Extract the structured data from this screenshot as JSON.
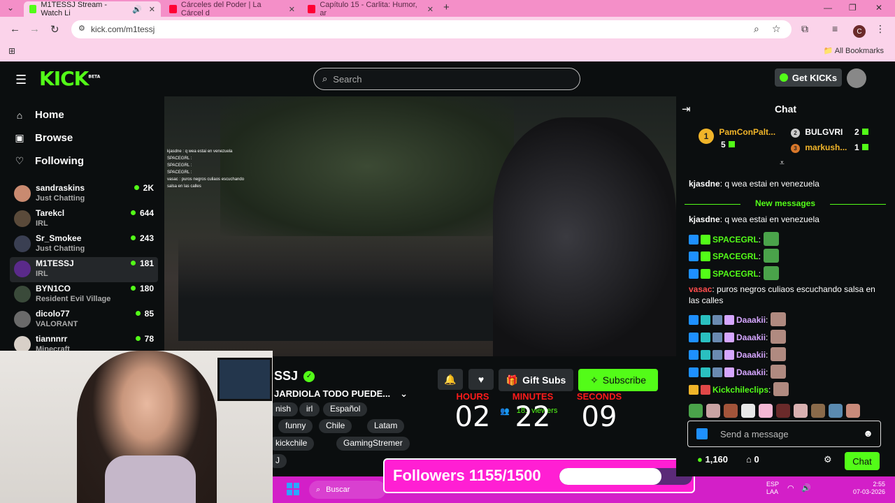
{
  "browser": {
    "tabs": [
      {
        "label": "M1TESSJ Stream - Watch Li",
        "favicon": "kick-icon"
      },
      {
        "label": "Cárceles del Poder | La Cárcel d",
        "favicon": "youtube-icon"
      },
      {
        "label": "Capítulo 15 - Carlita: Humor, ar",
        "favicon": "youtube-icon"
      }
    ],
    "new_tab": "+",
    "url": "kick.com/m1tessj",
    "profile_initial": "C",
    "all_bookmarks": "All Bookmarks"
  },
  "kick": {
    "logo": "KICK",
    "logo_sup": "BETA",
    "search_placeholder": "Search",
    "get_kicks": "Get KICKs"
  },
  "sidebar": {
    "nav": [
      {
        "label": "Home",
        "icon": "home-icon"
      },
      {
        "label": "Browse",
        "icon": "browse-icon"
      },
      {
        "label": "Following",
        "icon": "heart-icon"
      }
    ],
    "channels": [
      {
        "name": "sandraskins",
        "category": "Just Chatting",
        "viewers": "2K",
        "color": "#c98a70"
      },
      {
        "name": "Tarekcl",
        "category": "IRL",
        "viewers": "644",
        "color": "#5a4a3a"
      },
      {
        "name": "Sr_Smokee",
        "category": "Just Chatting",
        "viewers": "243",
        "color": "#3a3f52"
      },
      {
        "name": "M1TESSJ",
        "category": "IRL",
        "viewers": "181",
        "color": "#5a2a8a"
      },
      {
        "name": "BYN1CO",
        "category": "Resident Evil Village",
        "viewers": "180",
        "color": "#3a4a3a"
      },
      {
        "name": "dicolo77",
        "category": "VALORANT",
        "viewers": "85",
        "color": "#6a6a6a"
      },
      {
        "name": "tiannnrr",
        "category": "Minecraft",
        "viewers": "78",
        "color": "#d8d0c8"
      }
    ]
  },
  "stream": {
    "channel_name": "SSJ",
    "title": "JARDIOLA TODO PUEDE...",
    "tags": [
      "nish",
      "irl",
      "Español",
      "funny",
      "Chile",
      "Latam",
      "kickchile",
      "GamingStremer",
      "J"
    ],
    "gift_subs": "Gift Subs",
    "subscribe": "Subscribe",
    "viewers": "181 viewers",
    "overlay_chat": [
      "kjasdne : q wea estai en venezuela",
      "SPACEGRL :",
      "SPACEGRL :",
      "SPACEGRL :",
      "vasac : puros negros culiaos escuchando",
      "salsa en las calles"
    ]
  },
  "countdown": {
    "labels": [
      "HOURS",
      "MINUTES",
      "SECONDS"
    ],
    "values": [
      "02",
      "22",
      "09"
    ]
  },
  "followers_goal": {
    "label": "Followers 1155/1500",
    "current": 1155,
    "target": 1500
  },
  "taskbar": {
    "search": "Buscar",
    "lang": "ESP",
    "layout": "LAA",
    "time": "2:55",
    "date": "07-03-2026"
  },
  "chat": {
    "title": "Chat",
    "leaderboard": [
      {
        "rank": "1",
        "name": "PamConPalt...",
        "count": "5"
      },
      {
        "rank": "2",
        "name": "BULGVRI",
        "count": "2"
      },
      {
        "rank": "3",
        "name": "markush...",
        "count": "1"
      }
    ],
    "messages_before": [
      {
        "user": "kjasdne",
        "text": ": q wea estai en venezuela",
        "color": "#ffffff"
      }
    ],
    "new_messages_label": "New messages",
    "messages": [
      {
        "user": "kjasdne",
        "text": ": q wea estai en venezuela",
        "color": "#ffffff"
      },
      {
        "user": "SPACEGRL",
        "text": ":",
        "color": "#53fc18"
      },
      {
        "user": "SPACEGRL",
        "text": ":",
        "color": "#53fc18"
      },
      {
        "user": "SPACEGRL",
        "text": ":",
        "color": "#53fc18"
      },
      {
        "user": "vasac",
        "text": ": puros negros culiaos escuchando salsa en las calles",
        "color": "#ff4d4d"
      },
      {
        "user": "Daaakii",
        "text": ":",
        "color": "#d5a6ff"
      },
      {
        "user": "Daaakii",
        "text": ":",
        "color": "#d5a6ff"
      },
      {
        "user": "Daaakii",
        "text": ":",
        "color": "#d5a6ff"
      },
      {
        "user": "Daaakii",
        "text": ":",
        "color": "#d5a6ff"
      },
      {
        "user": "Kickchileclips",
        "text": ":",
        "color": "#53fc18"
      }
    ],
    "input_placeholder": "Send a message",
    "kicks_count": "1,160",
    "other_count": "0",
    "send_button": "Chat"
  }
}
